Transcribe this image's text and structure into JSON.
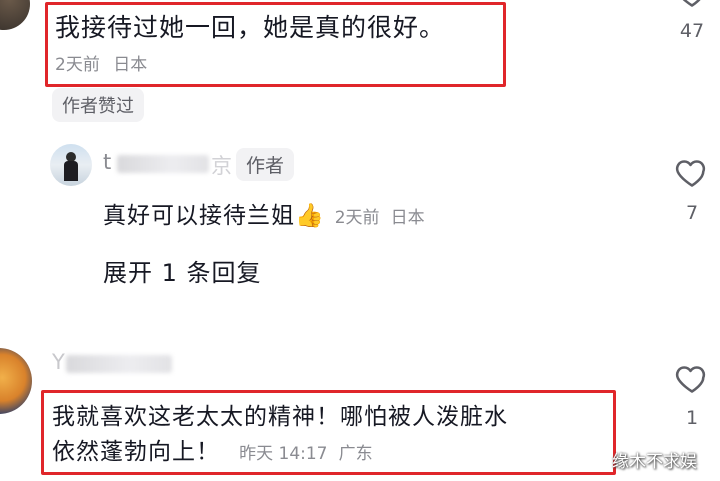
{
  "comments": [
    {
      "text": "我接待过她一回，她是真的很好。",
      "time": "2天前",
      "location": "日本",
      "like_count": "47",
      "liked_by_author_label": "作者赞过"
    },
    {
      "username_visible": "t",
      "username_tail": "京",
      "author_badge": "作者",
      "text": "真好可以接待兰姐",
      "emoji": "👍",
      "time": "2天前",
      "location": "日本",
      "like_count": "7",
      "expand_label": "展开 1 条回复"
    },
    {
      "username_visible": "Y",
      "text_line1": "我就喜欢这老太太的精神！哪怕被人泼脏水",
      "text_line2": "依然蓬勃向上！",
      "time": "昨天 14:17",
      "location": "广东",
      "like_count": "1"
    }
  ],
  "watermark": "缘木不求娱",
  "colors": {
    "highlight": "#e0262a",
    "text": "#161823",
    "meta": "#8a8b91"
  },
  "icons": [
    "heart-outline-icon",
    "avatar"
  ]
}
